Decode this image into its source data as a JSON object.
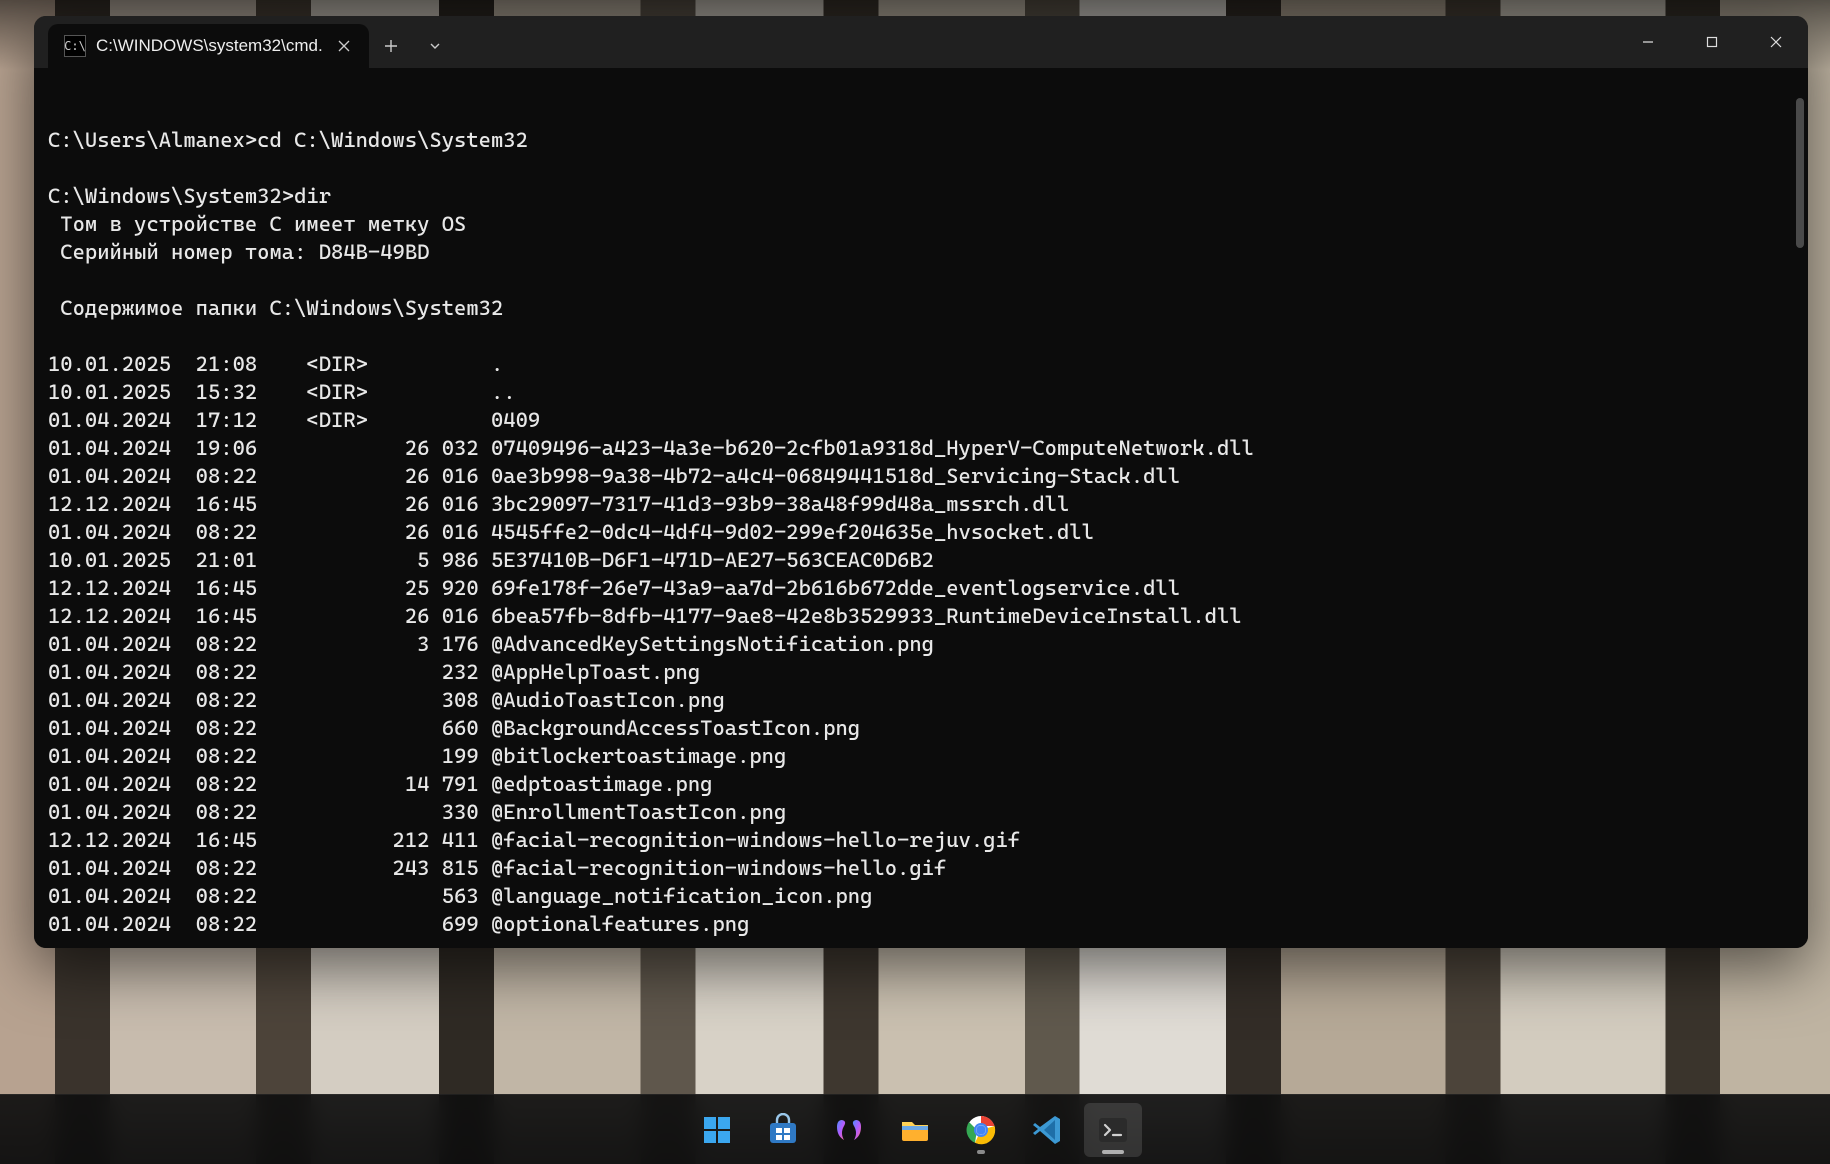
{
  "window": {
    "tab_title": "C:\\WINDOWS\\system32\\cmd.",
    "tab_icon_label": "cmd-icon",
    "new_tab_label": "New Tab",
    "dropdown_label": "Profiles",
    "minimize_label": "Minimize",
    "maximize_label": "Maximize",
    "close_label": "Close"
  },
  "terminal": {
    "lines": [
      "",
      "C:\\Users\\Almanex>cd C:\\Windows\\System32",
      "",
      "C:\\Windows\\System32>dir",
      " Том в устройстве C имеет метку OS",
      " Серийный номер тома: D84B-49BD",
      "",
      " Содержимое папки C:\\Windows\\System32",
      "",
      "10.01.2025  21:08    <DIR>          .",
      "10.01.2025  15:32    <DIR>          ..",
      "01.04.2024  17:12    <DIR>          0409",
      "01.04.2024  19:06            26 032 07409496-a423-4a3e-b620-2cfb01a9318d_HyperV-ComputeNetwork.dll",
      "01.04.2024  08:22            26 016 0ae3b998-9a38-4b72-a4c4-06849441518d_Servicing-Stack.dll",
      "12.12.2024  16:45            26 016 3bc29097-7317-41d3-93b9-38a48f99d48a_mssrch.dll",
      "01.04.2024  08:22            26 016 4545ffe2-0dc4-4df4-9d02-299ef204635e_hvsocket.dll",
      "10.01.2025  21:01             5 986 5E37410B-D6F1-471D-AE27-563CEAC0D6B2",
      "12.12.2024  16:45            25 920 69fe178f-26e7-43a9-aa7d-2b616b672dde_eventlogservice.dll",
      "12.12.2024  16:45            26 016 6bea57fb-8dfb-4177-9ae8-42e8b3529933_RuntimeDeviceInstall.dll",
      "01.04.2024  08:22             3 176 @AdvancedKeySettingsNotification.png",
      "01.04.2024  08:22               232 @AppHelpToast.png",
      "01.04.2024  08:22               308 @AudioToastIcon.png",
      "01.04.2024  08:22               660 @BackgroundAccessToastIcon.png",
      "01.04.2024  08:22               199 @bitlockertoastimage.png",
      "01.04.2024  08:22            14 791 @edptoastimage.png",
      "01.04.2024  08:22               330 @EnrollmentToastIcon.png",
      "12.12.2024  16:45           212 411 @facial-recognition-windows-hello-rejuv.gif",
      "01.04.2024  08:22           243 815 @facial-recognition-windows-hello.gif",
      "01.04.2024  08:22               563 @language_notification_icon.png",
      "01.04.2024  08:22               699 @optionalfeatures.png"
    ]
  },
  "taskbar": {
    "items": [
      {
        "name": "start",
        "label": "Start",
        "active": false,
        "running": false
      },
      {
        "name": "store",
        "label": "Microsoft Store",
        "active": false,
        "running": false
      },
      {
        "name": "copilot",
        "label": "Copilot",
        "active": false,
        "running": false
      },
      {
        "name": "explorer",
        "label": "File Explorer",
        "active": false,
        "running": false
      },
      {
        "name": "chrome",
        "label": "Google Chrome",
        "active": false,
        "running": true
      },
      {
        "name": "vscode",
        "label": "Visual Studio Code",
        "active": false,
        "running": false
      },
      {
        "name": "terminal",
        "label": "Terminal",
        "active": true,
        "running": true
      }
    ]
  }
}
